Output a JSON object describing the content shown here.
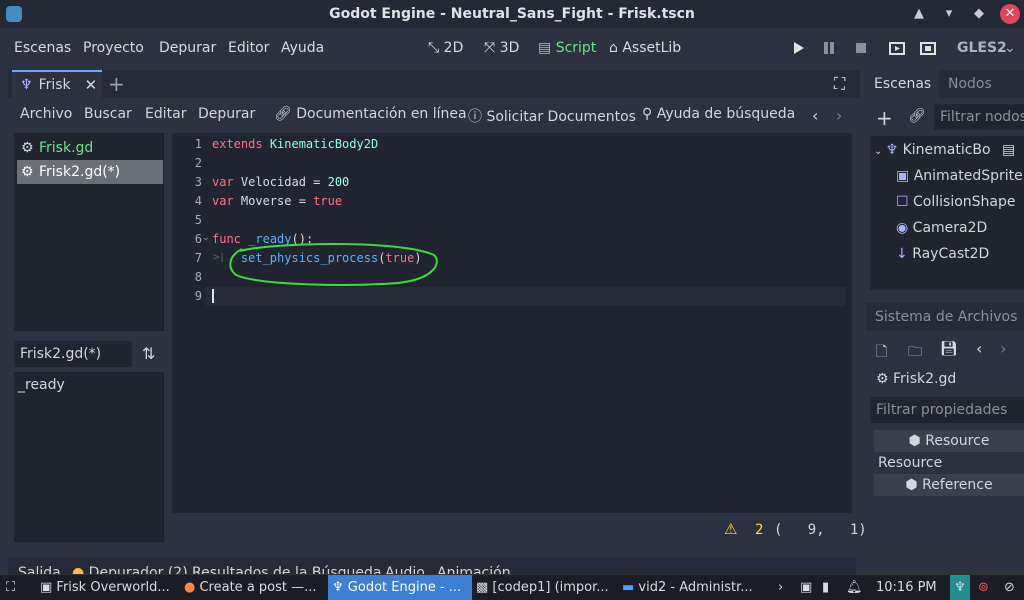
{
  "window": {
    "title": "Godot Engine - Neutral_Sans_Fight - Frisk.tscn"
  },
  "menu": {
    "items": [
      "Escenas",
      "Proyecto",
      "Depurar",
      "Editor",
      "Ayuda"
    ]
  },
  "workspaces": {
    "items": [
      "2D",
      "3D",
      "Script",
      "AssetLib"
    ],
    "active": "Script"
  },
  "renderer": "GLES2",
  "scene_tabs": {
    "active": "Frisk"
  },
  "script_toolbar": {
    "items": [
      "Archivo",
      "Buscar",
      "Editar",
      "Depurar"
    ],
    "docs": "Documentación en línea",
    "request_docs": "Solicitar Documentos",
    "search_help": "Ayuda de búsqueda"
  },
  "script_list": {
    "items": [
      "Frisk.gd",
      "Frisk2.gd(*)"
    ],
    "selected": "Frisk2.gd(*)"
  },
  "method_filter": "Frisk2.gd(*)",
  "methods": [
    "_ready"
  ],
  "code": {
    "lines": [
      {
        "n": "1",
        "parts": [
          [
            "kw",
            "extends"
          ],
          [
            "",
            " "
          ],
          [
            "ty",
            "KinematicBody2D"
          ]
        ]
      },
      {
        "n": "2",
        "parts": []
      },
      {
        "n": "3",
        "parts": [
          [
            "kw",
            "var"
          ],
          [
            "",
            " Velocidad = "
          ],
          [
            "num",
            "200"
          ]
        ]
      },
      {
        "n": "4",
        "parts": [
          [
            "kw",
            "var"
          ],
          [
            "",
            " Moverse = "
          ],
          [
            "kw",
            "true"
          ]
        ]
      },
      {
        "n": "5",
        "parts": []
      },
      {
        "n": "6",
        "parts": [
          [
            "kw",
            "func"
          ],
          [
            "",
            " "
          ],
          [
            "fn",
            "_ready"
          ],
          [
            "",
            "():"
          ]
        ]
      },
      {
        "n": "7",
        "parts": [
          [
            "",
            "    "
          ],
          [
            "fn",
            "set_physics_process"
          ],
          [
            "",
            "("
          ],
          [
            "kw",
            "true"
          ],
          [
            "",
            ")"
          ]
        ]
      },
      {
        "n": "8",
        "parts": []
      },
      {
        "n": "9",
        "parts": []
      }
    ]
  },
  "editor_status": {
    "warnings": "2",
    "position": "(   9,   1)"
  },
  "bottom_tabs": [
    "Salida",
    "Depurador (2)",
    "Resultados de la Búsqueda",
    "Audio",
    "Animación"
  ],
  "scene_panel": {
    "tabs": [
      "Escenas",
      "Nodos"
    ],
    "filter_placeholder": "Filtrar nodos",
    "root": "KinematicBo",
    "children": [
      "AnimatedSprite",
      "CollisionShape",
      "Camera2D",
      "RayCast2D"
    ]
  },
  "fs_panel": {
    "title": "Sistema de Archivos",
    "file": "Frisk2.gd",
    "filter_placeholder": "Filtrar propiedades",
    "resource_btn": "Resource",
    "resource_label": "Resource",
    "reference_btn": "Reference"
  },
  "taskbar": {
    "tasks": [
      "Frisk Overworld...",
      "Create a post —...",
      "Godot Engine - ...",
      "[codep1] (impor...",
      "vid2 - Administr..."
    ],
    "clock": "10:16 PM"
  },
  "colors": {
    "accent": "#6ee08a",
    "annotation": "#3ddc3d",
    "taskbar_active": "#3d7fd6"
  }
}
